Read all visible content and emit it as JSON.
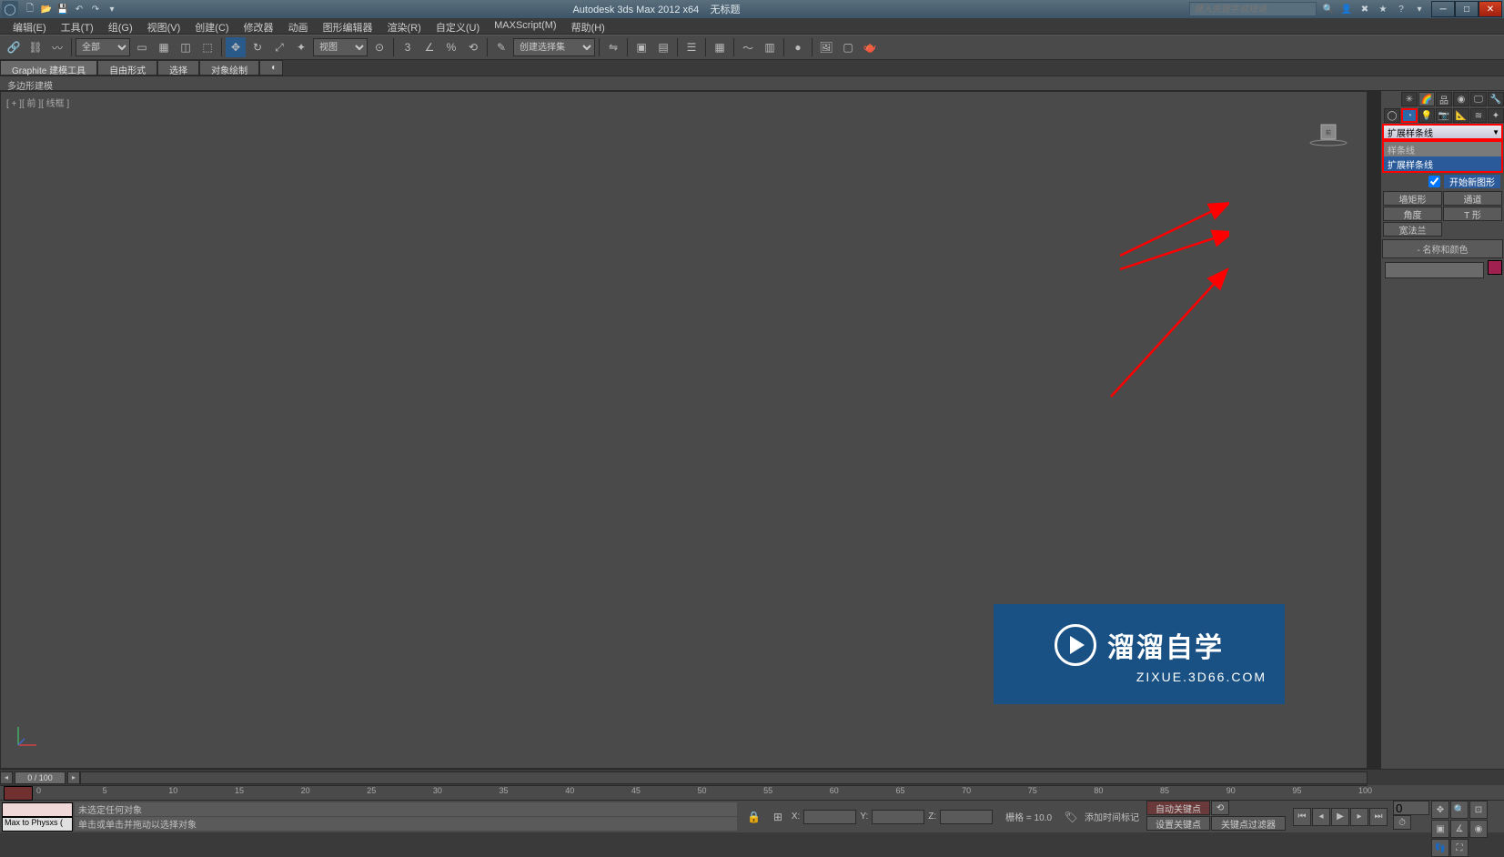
{
  "title": {
    "app": "Autodesk 3ds Max  2012 x64",
    "doc": "无标题"
  },
  "search_placeholder": "键入关键字或短语",
  "menus": [
    "编辑(E)",
    "工具(T)",
    "组(G)",
    "视图(V)",
    "创建(C)",
    "修改器",
    "动画",
    "图形编辑器",
    "渲染(R)",
    "自定义(U)",
    "MAXScript(M)",
    "帮助(H)"
  ],
  "toolbar": {
    "sel_filter": "全部",
    "set_label": "视图",
    "named_sel": "创建选择集"
  },
  "ribbon": {
    "tab1": "Graphite 建模工具",
    "tab2": "自由形式",
    "tab3": "选择",
    "tab4": "对象绘制",
    "sub": "多边形建模"
  },
  "viewport": {
    "label": "[ + ][ 前 ][ 线框 ]"
  },
  "panel": {
    "dropdown_value": "扩展样条线",
    "list": [
      "样条线",
      "扩展样条线"
    ],
    "autogrid": "开始新图形",
    "obj_buttons": [
      "墙矩形",
      "通道",
      "角度",
      "T 形",
      "宽法兰",
      ""
    ],
    "rollout_name": "名称和颜色"
  },
  "time": {
    "slider": "0 / 100",
    "ticks": [
      "0",
      "5",
      "10",
      "15",
      "20",
      "25",
      "30",
      "35",
      "40",
      "45",
      "50",
      "55",
      "60",
      "65",
      "70",
      "75",
      "80",
      "85",
      "90",
      "95",
      "100"
    ]
  },
  "status": {
    "script": "Max to Physxs (",
    "line1": "未选定任何对象",
    "line2": "单击或单击并拖动以选择对象",
    "grid": "栅格 = 10.0",
    "x": "X:",
    "y": "Y:",
    "z": "Z:",
    "addtime": "添加时间标记",
    "autokey": "自动关键点",
    "setkey": "设置关键点",
    "keyfilter": "关键点过滤器"
  },
  "watermark": {
    "brand": "溜溜自学",
    "url": "ZIXUE.3D66.COM"
  }
}
